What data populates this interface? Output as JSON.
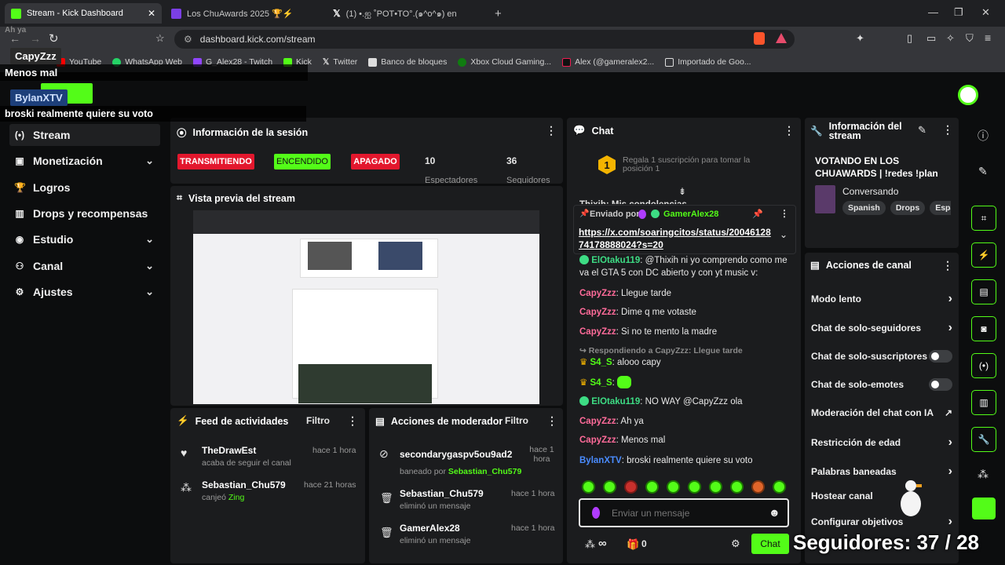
{
  "browser": {
    "tabs": [
      {
        "label": "Stream - Kick Dashboard",
        "color": "#53fc18"
      },
      {
        "label": "Los ChuAwards 2025 🏆⚡",
        "color": "#7b3fe4"
      },
      {
        "label": "(1) •.ஐ ˚POT•TO°.(๑^o^๑) en",
        "color": "#ffffff"
      }
    ],
    "new_tab": "+",
    "url": "dashboard.kick.com/stream",
    "window_controls": [
      "—",
      "❐",
      "✕"
    ],
    "bookmarks": [
      "YouTube",
      "WhatsApp Web",
      "G_Alex28 - Twitch",
      "Kick",
      "Twitter",
      "Banco de bloques",
      "Xbox Cloud Gaming...",
      "Alex (@gameralex2...",
      "Importado de Goo..."
    ]
  },
  "sidebar": {
    "items": [
      {
        "label": "Stream",
        "icon": "(•)",
        "chevron": false
      },
      {
        "label": "Monetización",
        "icon": "▣",
        "chevron": true
      },
      {
        "label": "Logros",
        "icon": "🏆",
        "chevron": false
      },
      {
        "label": "Drops y recompensas",
        "icon": "▥",
        "chevron": false
      },
      {
        "label": "Estudio",
        "icon": "◉",
        "chevron": true
      },
      {
        "label": "Canal",
        "icon": "⚇",
        "chevron": true
      },
      {
        "label": "Ajustes",
        "icon": "⚙",
        "chevron": true
      }
    ]
  },
  "session": {
    "title": "Información de la sesión",
    "states": [
      "TRANSMITIENDO",
      "ENCENDIDO",
      "APAGADO"
    ],
    "spectators": "10",
    "spectators_label": "Espectadores",
    "followers": "36",
    "followers_label": "Seguidores"
  },
  "preview": {
    "title": "Vista previa del stream"
  },
  "feed": {
    "title": "Feed de actividades",
    "filter": "Filtro",
    "items": [
      {
        "name": "TheDrawEst",
        "time": "hace 1 hora",
        "action": "acaba de seguir el canal",
        "extra": ""
      },
      {
        "name": "Sebastian_Chu579",
        "time": "hace 21 horas",
        "action": "canjeó",
        "extra": "Zing"
      }
    ]
  },
  "modactions": {
    "title": "Acciones de moderador",
    "filter": "Filtro",
    "items": [
      {
        "name": "secondarygaspv5ou9ad2",
        "time": "hace 1 hora",
        "action": "baneado por",
        "extra": "Sebastian_Chu579"
      },
      {
        "name": "Sebastian_Chu579",
        "time": "hace 1 hora",
        "action": "eliminó un mensaje",
        "extra": ""
      },
      {
        "name": "GamerAlex28",
        "time": "hace 1 hora",
        "action": "eliminó un mensaje",
        "extra": ""
      }
    ]
  },
  "chat": {
    "title": "Chat",
    "gift_number": "1",
    "gift_text": "Regala 1 suscripción para tomar la posición 1",
    "truncated": "Thixih: Mis condolencias",
    "pinned_by": "Enviado por",
    "pinned_user": "GamerAlex28",
    "pinned_link": "https://x.com/soaringcitos/status/2004612874178888024?s=20",
    "messages": [
      {
        "user": "ElOtaku119",
        "color": "#3ddc84",
        "text": ": @Thixih ni yo comprendo como me va el GTA 5 con DC abierto y con yt music v:"
      },
      {
        "user": "CapyZzz",
        "color": "#ff6b9a",
        "text": ": Llegue tarde"
      },
      {
        "user": "CapyZzz",
        "color": "#ff6b9a",
        "text": ": Dime q me votaste"
      },
      {
        "user": "CapyZzz",
        "color": "#ff6b9a",
        "text": ": Si no te mento la madre"
      }
    ],
    "reply_to": "Respondiendo a CapyZzz: Llegue tarde",
    "messages2": [
      {
        "user": "S4_S",
        "color": "#53fc18",
        "text": ": alooo capy"
      },
      {
        "user": "S4_S",
        "color": "#53fc18",
        "text": ":"
      },
      {
        "user": "ElOtaku119",
        "color": "#3ddc84",
        "text": ": NO WAY @CapyZzz ola"
      },
      {
        "user": "CapyZzz",
        "color": "#ff6b9a",
        "text": ": Ah ya"
      },
      {
        "user": "CapyZzz",
        "color": "#ff6b9a",
        "text": ": Menos mal"
      },
      {
        "user": "BylanXTV",
        "color": "#4a8cff",
        "text": ": broski realmente quiere su voto"
      }
    ],
    "placeholder": "Enviar un mensaje",
    "send": "Chat",
    "points": "∞",
    "count": "0"
  },
  "streaminfo": {
    "title": "Información del stream",
    "stream_title": "VOTANDO EN LOS CHUAWARDS | !redes !plan",
    "category": "Conversando",
    "tags": [
      "Spanish",
      "Drops",
      "Espa"
    ]
  },
  "channel_actions": {
    "title": "Acciones de canal",
    "items": [
      {
        "label": "Modo lento",
        "control": "›"
      },
      {
        "label": "Chat de solo-seguidores",
        "control": "›"
      },
      {
        "label": "Chat de solo-suscriptores",
        "control": "toggle"
      },
      {
        "label": "Chat de solo-emotes",
        "control": "toggle"
      },
      {
        "label": "Moderación del chat con IA",
        "control": "↗"
      },
      {
        "label": "Restricción de edad",
        "control": "›"
      },
      {
        "label": "Palabras baneadas",
        "control": "›"
      },
      {
        "label": "Hostear canal",
        "control": ""
      },
      {
        "label": "Configurar objetivos",
        "control": "›"
      }
    ]
  },
  "overlay": {
    "ah_ya": "Ah ya",
    "capy": "CapyZzz",
    "menos": "Menos mal",
    "bylan": "BylanXTV",
    "broski": "broski realmente quiere su voto",
    "followers": "Seguidores: 37 / 28"
  }
}
